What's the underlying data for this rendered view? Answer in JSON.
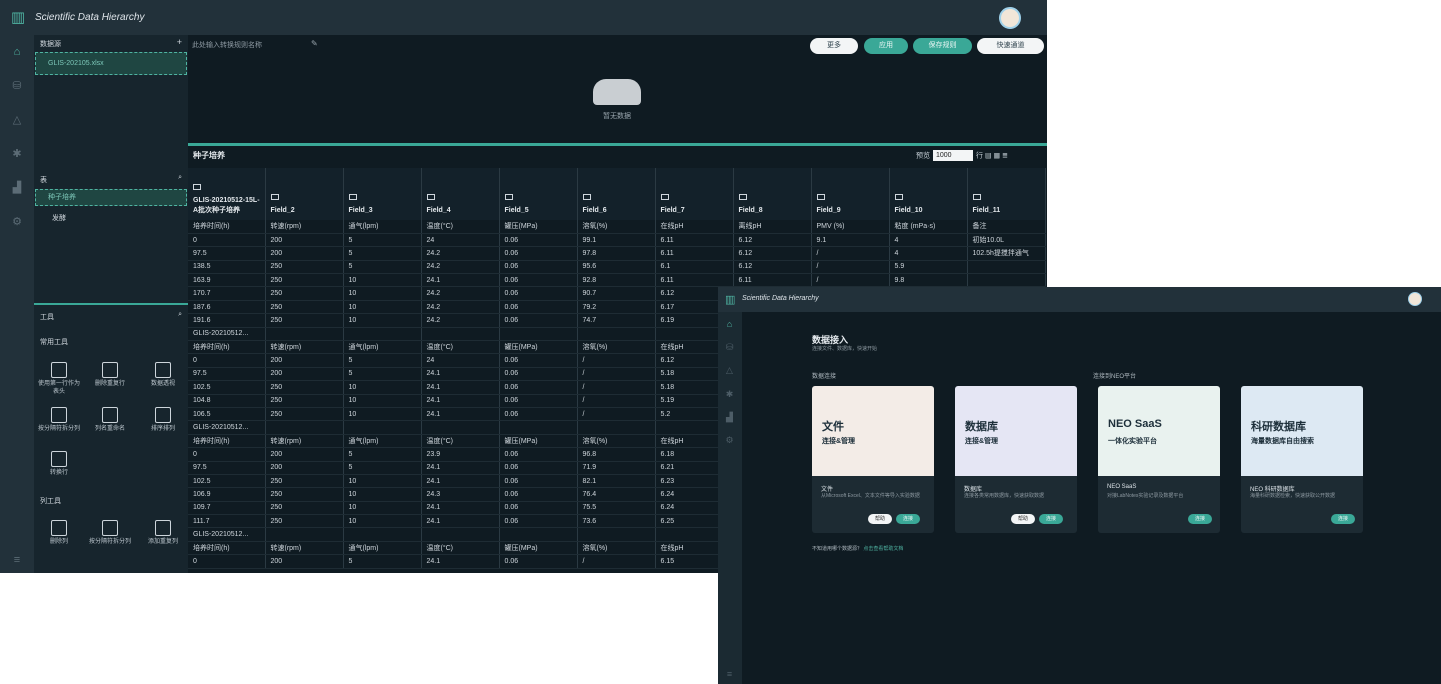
{
  "app": {
    "title": "Scientific Data Hierarchy"
  },
  "left": {
    "datasource_title": "数据源",
    "file": "GLIS-202105.xlsx",
    "table_title": "表",
    "tables": [
      "种子培养",
      "发酵"
    ],
    "tools_title": "工具",
    "common_tools": "常用工具",
    "tools": [
      "使用第一行作为表头",
      "删除重复行",
      "数据透视",
      "按分隔符拆分列",
      "列名重命名",
      "排序排列",
      "转换行"
    ],
    "column_tools": "列工具",
    "col_tools": [
      "删除列",
      "按分隔符拆分列",
      "添加重复列"
    ]
  },
  "toolbar": {
    "rule_placeholder": "此处输入转换规则名称",
    "more": "更多",
    "apply": "应用",
    "save": "保存规则",
    "quick": "快速通道"
  },
  "empty_text": "暂无数据",
  "sheet": {
    "name": "种子培养",
    "preview_label": "预览",
    "rows": "1000",
    "rows_unit": "行"
  },
  "table": {
    "headers": [
      "GLIS-20210512-15L-A批次种子培养",
      "Field_2",
      "Field_3",
      "Field_4",
      "Field_5",
      "Field_6",
      "Field_7",
      "Field_8",
      "Field_9",
      "Field_10",
      "Field_11"
    ],
    "rows": [
      [
        "培养时间(h)",
        "转速(rpm)",
        "通气(lpm)",
        "温度(°C)",
        "罐压(MPa)",
        "溶氧(%)",
        "在线pH",
        "离线pH",
        "PMV (%)",
        "粘度 (mPa·s)",
        "备注"
      ],
      [
        "0",
        "200",
        "5",
        "24",
        "0.06",
        "99.1",
        "6.11",
        "6.12",
        "9.1",
        "4",
        "初始10.0L"
      ],
      [
        "97.5",
        "200",
        "5",
        "24.2",
        "0.06",
        "97.8",
        "6.11",
        "6.12",
        "/",
        "4",
        "102.5h提搅拌通气"
      ],
      [
        "138.5",
        "250",
        "5",
        "24.2",
        "0.06",
        "95.6",
        "6.1",
        "6.12",
        "/",
        "5.9",
        ""
      ],
      [
        "163.9",
        "250",
        "10",
        "24.1",
        "0.06",
        "92.8",
        "6.11",
        "6.11",
        "/",
        "9.8",
        ""
      ],
      [
        "170.7",
        "250",
        "10",
        "24.2",
        "0.06",
        "90.7",
        "6.12",
        "",
        "",
        "",
        ""
      ],
      [
        "187.6",
        "250",
        "10",
        "24.2",
        "0.06",
        "79.2",
        "6.17",
        "",
        "",
        "",
        ""
      ],
      [
        "191.6",
        "250",
        "10",
        "24.2",
        "0.06",
        "74.7",
        "6.19",
        "",
        "",
        "",
        ""
      ],
      [
        "GLIS-20210512...",
        "",
        "",
        "",
        "",
        "",
        "",
        "",
        "",
        "",
        ""
      ],
      [
        "培养时间(h)",
        "转速(rpm)",
        "通气(lpm)",
        "温度(°C)",
        "罐压(MPa)",
        "溶氧(%)",
        "在线pH",
        "",
        "",
        "",
        ""
      ],
      [
        "0",
        "200",
        "5",
        "24",
        "0.06",
        "/",
        "6.12",
        "",
        "",
        "",
        ""
      ],
      [
        "97.5",
        "200",
        "5",
        "24.1",
        "0.06",
        "/",
        "5.18",
        "",
        "",
        "",
        ""
      ],
      [
        "102.5",
        "250",
        "10",
        "24.1",
        "0.06",
        "/",
        "5.18",
        "",
        "",
        "",
        ""
      ],
      [
        "104.8",
        "250",
        "10",
        "24.1",
        "0.06",
        "/",
        "5.19",
        "",
        "",
        "",
        ""
      ],
      [
        "106.5",
        "250",
        "10",
        "24.1",
        "0.06",
        "/",
        "5.2",
        "",
        "",
        "",
        ""
      ],
      [
        "GLIS-20210512...",
        "",
        "",
        "",
        "",
        "",
        "",
        "",
        "",
        "",
        ""
      ],
      [
        "培养时间(h)",
        "转速(rpm)",
        "通气(lpm)",
        "温度(°C)",
        "罐压(MPa)",
        "溶氧(%)",
        "在线pH",
        "",
        "",
        "",
        ""
      ],
      [
        "0",
        "200",
        "5",
        "23.9",
        "0.06",
        "96.8",
        "6.18",
        "",
        "",
        "",
        ""
      ],
      [
        "97.5",
        "200",
        "5",
        "24.1",
        "0.06",
        "71.9",
        "6.21",
        "",
        "",
        "",
        ""
      ],
      [
        "102.5",
        "250",
        "10",
        "24.1",
        "0.06",
        "82.1",
        "6.23",
        "",
        "",
        "",
        ""
      ],
      [
        "106.9",
        "250",
        "10",
        "24.3",
        "0.06",
        "76.4",
        "6.24",
        "",
        "",
        "",
        ""
      ],
      [
        "109.7",
        "250",
        "10",
        "24.1",
        "0.06",
        "75.5",
        "6.24",
        "",
        "",
        "",
        ""
      ],
      [
        "111.7",
        "250",
        "10",
        "24.1",
        "0.06",
        "73.6",
        "6.25",
        "",
        "",
        "",
        ""
      ],
      [
        "GLIS-20210512...",
        "",
        "",
        "",
        "",
        "",
        "",
        "",
        "",
        "",
        ""
      ],
      [
        "培养时间(h)",
        "转速(rpm)",
        "通气(lpm)",
        "温度(°C)",
        "罐压(MPa)",
        "溶氧(%)",
        "在线pH",
        "",
        "",
        "",
        ""
      ],
      [
        "0",
        "200",
        "5",
        "24.1",
        "0.06",
        "/",
        "6.15",
        "",
        "",
        "",
        ""
      ]
    ]
  },
  "import": {
    "title": "数据接入",
    "subtitle": "连接文件、数据库，快速开始",
    "local_label": "数据连接",
    "neo_label": "连接到NEO平台",
    "link_prefix": "不知道用哪个数据源？",
    "link": "点击查看帮助文档",
    "cards": [
      {
        "big": "文件",
        "sm": "连接&管理",
        "title": "文件",
        "desc": "从Microsoft Excel、文本文件等导入实验数据",
        "btns": [
          "帮助",
          "连接"
        ]
      },
      {
        "big": "数据库",
        "sm": "连接&管理",
        "title": "数据库",
        "desc": "连接各类常用数据库，快速获取数据",
        "btns": [
          "帮助",
          "连接"
        ]
      },
      {
        "big": "NEO SaaS",
        "sm": "一体化实验平台",
        "title": "NEO SaaS",
        "desc": "对接LabNotes实验记录及数据平台",
        "btns": [
          "连接"
        ]
      },
      {
        "big": "科研数据库",
        "sm": "海量数据库自由搜索",
        "title": "NEO 科研数据库",
        "desc": "海量科研数据检索，快速获取公开数据",
        "btns": [
          "连接"
        ]
      }
    ]
  }
}
